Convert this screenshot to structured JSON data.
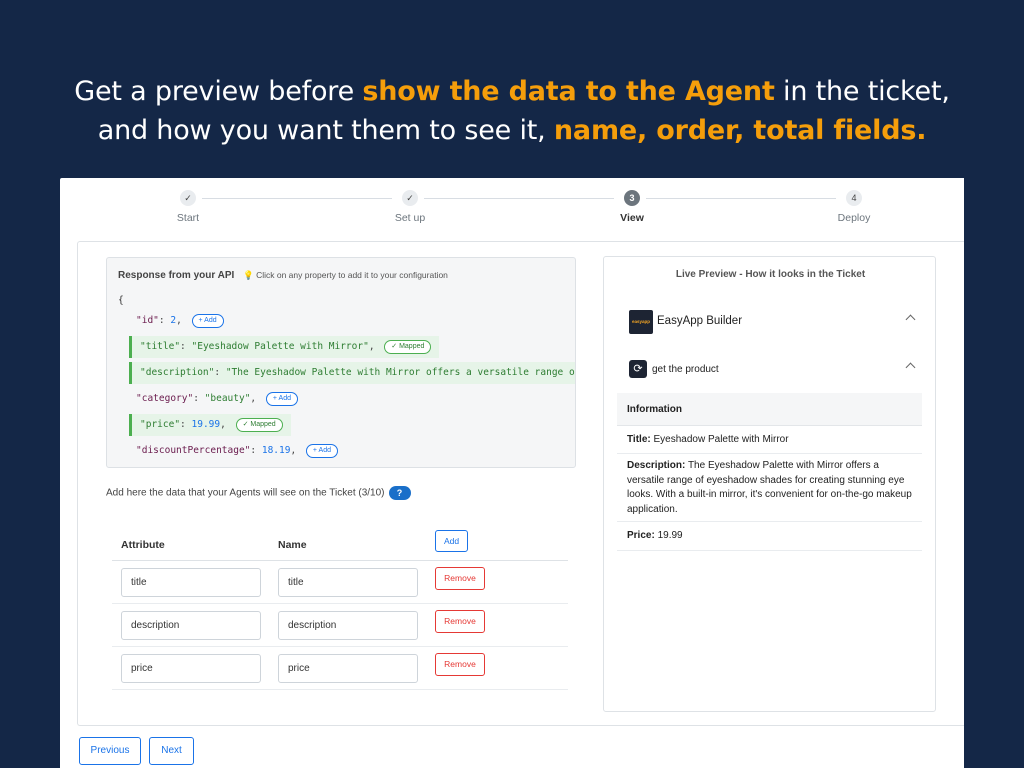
{
  "headline": {
    "line1_pre": "Get a preview before ",
    "line1_hl": "show the data to the Agent",
    "line1_post": " in the ticket,",
    "line2_pre": "and how you want them to see it, ",
    "line2_hl1": "name",
    "line2_sep1": ", ",
    "line2_hl2": "order",
    "line2_sep2": ", ",
    "line2_hl3": "total fields",
    "line2_end": "."
  },
  "stepper": {
    "steps": [
      {
        "icon": "✓",
        "label": "Start",
        "state": "done"
      },
      {
        "icon": "✓",
        "label": "Set up",
        "state": "done"
      },
      {
        "icon": "3",
        "label": "View",
        "state": "active"
      },
      {
        "icon": "4",
        "label": "Deploy",
        "state": "pending"
      }
    ]
  },
  "api": {
    "title": "Response from your API",
    "tip_icon": "💡",
    "tip": "Click on any property to add it to your configuration",
    "open_brace": "{",
    "properties": [
      {
        "key": "\"id\"",
        "value": "2",
        "value_type": "number",
        "action": "+ Add",
        "mapped": false
      },
      {
        "key": "\"title\"",
        "value": "\"Eyeshadow Palette with Mirror\"",
        "value_type": "string",
        "action": "✓ Mapped",
        "mapped": true
      },
      {
        "key": "\"description\"",
        "value": "\"The Eyeshadow Palette with Mirror offers a versatile range of",
        "value_type": "string",
        "action": "",
        "mapped": true
      },
      {
        "key": "\"category\"",
        "value": "\"beauty\"",
        "value_type": "string",
        "action": "+ Add",
        "mapped": false
      },
      {
        "key": "\"price\"",
        "value": "19.99",
        "value_type": "number",
        "action": "✓ Mapped",
        "mapped": true
      },
      {
        "key": "\"discountPercentage\"",
        "value": "18.19",
        "value_type": "number",
        "action": "+ Add",
        "mapped": false
      }
    ]
  },
  "agents_text": "Add here the data that your Agents will see on the Ticket (3/10)",
  "help_label": "?",
  "table": {
    "col_attribute": "Attribute",
    "col_name": "Name",
    "add_label": "Add",
    "remove_label": "Remove",
    "rows": [
      {
        "attribute": "title",
        "name": "title"
      },
      {
        "attribute": "description",
        "name": "description"
      },
      {
        "attribute": "price",
        "name": "price"
      }
    ]
  },
  "preview": {
    "title": "Live Preview - How it looks in the Ticket",
    "logo_text": "easyapp",
    "app_name": "EasyApp Builder",
    "sync_icon": "⟳",
    "product_label": "get the product",
    "info_header": "Information",
    "items": [
      {
        "label": "Title:",
        "value": "Eyeshadow Palette with Mirror"
      },
      {
        "label": "Description:",
        "value": "The Eyeshadow Palette with Mirror offers a versatile range of eyeshadow shades for creating stunning eye looks. With a built-in mirror, it's convenient for on-the-go makeup application."
      },
      {
        "label": "Price:",
        "value": "19.99"
      }
    ]
  },
  "footer": {
    "previous_label": "Previous",
    "next_label": "Next"
  }
}
